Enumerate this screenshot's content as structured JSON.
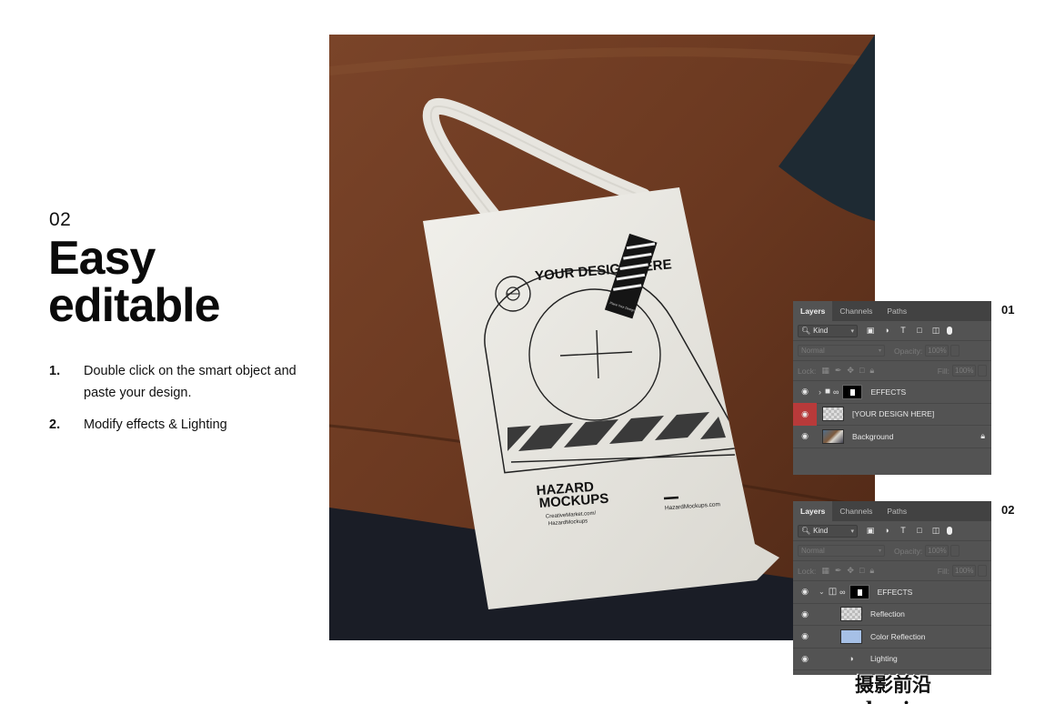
{
  "intro": {
    "step_number": "02",
    "headline_line1": "Easy",
    "headline_line2": "editable",
    "steps": [
      {
        "num": "1.",
        "text": "Double click on the smart object and paste your design."
      },
      {
        "num": "2.",
        "text": "Modify effects & Lighting"
      }
    ]
  },
  "mockup": {
    "bag_heading": "YOUR DESIGN HERE",
    "brand_line1": "HAZARD",
    "brand_line2": "MOCKUPS",
    "small_text1": "CreativeMarket.com/",
    "small_text2": "HazardMockups",
    "url_text": "HazardMockups.com",
    "tag_text": "Place Your Design Here",
    "colors": {
      "leather": "#6b3a22",
      "bag": "#ecebe6",
      "pillow": "#1e2a33"
    }
  },
  "panels": [
    {
      "label": "01",
      "tabs": [
        "Layers",
        "Channels",
        "Paths"
      ],
      "kind": "Kind",
      "blend": "Normal",
      "opacity_label": "Opacity:",
      "opacity": "100%",
      "lock_label": "Lock:",
      "fill_label": "Fill:",
      "fill": "100%",
      "layers": [
        "EFFECTS",
        "[YOUR DESIGN HERE]",
        "Background"
      ]
    },
    {
      "label": "02",
      "tabs": [
        "Layers",
        "Channels",
        "Paths"
      ],
      "kind": "Kind",
      "blend": "Normal",
      "opacity_label": "Opacity:",
      "opacity": "100%",
      "lock_label": "Lock:",
      "fill_label": "Fill:",
      "fill": "100%",
      "layers": [
        "EFFECTS",
        "Reflection",
        "Color Reflection",
        "Lighting"
      ]
    }
  ],
  "watermark": "摄影前沿sheyingzyz.com"
}
